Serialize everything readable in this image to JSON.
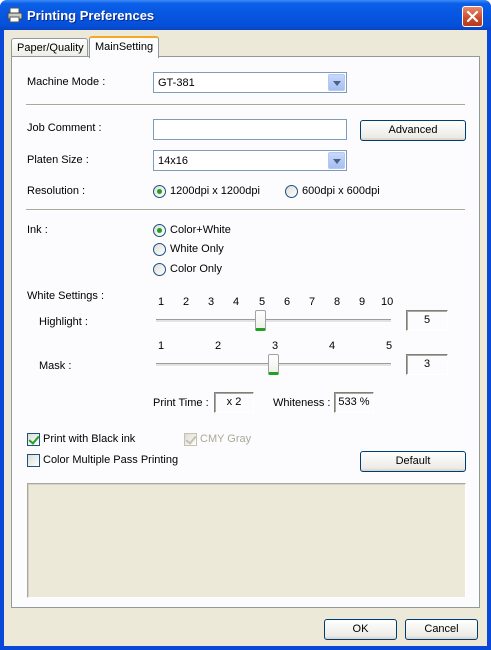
{
  "window": {
    "title": "Printing Preferences"
  },
  "tabs": [
    {
      "label": "Paper/Quality",
      "active": false
    },
    {
      "label": "MainSetting",
      "active": true
    }
  ],
  "machine_mode": {
    "label": "Machine Mode :",
    "value": "GT-381"
  },
  "job_comment": {
    "label": "Job Comment :",
    "value": "",
    "advanced_label": "Advanced"
  },
  "platen_size": {
    "label": "Platen Size :",
    "value": "14x16"
  },
  "resolution": {
    "label": "Resolution :",
    "options": [
      {
        "label": "1200dpi x 1200dpi",
        "selected": true
      },
      {
        "label": "600dpi x 600dpi",
        "selected": false
      }
    ]
  },
  "ink": {
    "label": "Ink :",
    "options": [
      {
        "label": "Color+White",
        "selected": true
      },
      {
        "label": "White Only",
        "selected": false
      },
      {
        "label": "Color Only",
        "selected": false
      }
    ]
  },
  "white_settings": {
    "label": "White Settings :",
    "highlight": {
      "label": "Highlight :",
      "ticks": [
        "1",
        "2",
        "3",
        "4",
        "5",
        "6",
        "7",
        "8",
        "9",
        "10"
      ],
      "value": 5,
      "display": "5"
    },
    "mask": {
      "label": "Mask :",
      "ticks": [
        "1",
        "2",
        "3",
        "4",
        "5"
      ],
      "value": 3,
      "display": "3"
    }
  },
  "print_time": {
    "label": "Print Time :",
    "value": "x 2"
  },
  "whiteness": {
    "label": "Whiteness :",
    "value": "533 %"
  },
  "options": {
    "print_black_ink": {
      "label": "Print with Black ink",
      "checked": true
    },
    "cmy_gray": {
      "label": "CMY Gray",
      "checked": true,
      "enabled": false
    },
    "color_multi_pass": {
      "label": "Color Multiple Pass Printing",
      "checked": false
    },
    "default_label": "Default"
  },
  "footer": {
    "ok_label": "OK",
    "cancel_label": "Cancel"
  },
  "colors": {
    "titlebar": "#0756e0",
    "dialog_bg": "#ece9d8",
    "accent_green": "#21a121"
  }
}
